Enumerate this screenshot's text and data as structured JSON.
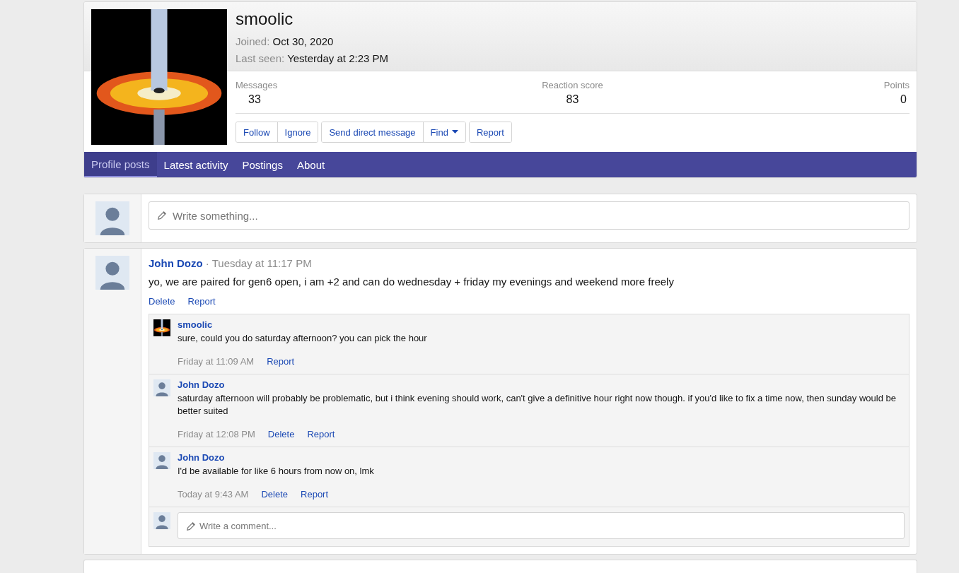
{
  "profile": {
    "name": "smoolic",
    "facts": [
      {
        "label": "Joined:",
        "value": "Oct 30, 2020"
      },
      {
        "label": "Last seen:",
        "value": "Yesterday at 2:23 PM"
      }
    ],
    "stats": [
      {
        "label": "Messages",
        "value": "33"
      },
      {
        "label": "Reaction score",
        "value": "83"
      },
      {
        "label": "Points",
        "value": "0"
      }
    ],
    "button_groups": [
      [
        {
          "label": "Follow",
          "has_menu": false
        },
        {
          "label": "Ignore",
          "has_menu": false
        }
      ],
      [
        {
          "label": "Send direct message",
          "has_menu": false
        },
        {
          "label": "Find",
          "has_menu": true
        }
      ],
      [
        {
          "label": "Report",
          "has_menu": false
        }
      ]
    ]
  },
  "tabs": [
    {
      "label": "Profile posts",
      "selected": true
    },
    {
      "label": "Latest activity",
      "selected": false
    },
    {
      "label": "Postings",
      "selected": false
    },
    {
      "label": "About",
      "selected": false
    }
  ],
  "composer": {
    "placeholder": "Write something..."
  },
  "posts": [
    {
      "author": "John Dozo",
      "separator": "·",
      "time": "Tuesday at 11:17 PM",
      "body": "yo, we are paired for gen6 open, i am +2 and can do wednesday + friday my evenings and weekend more freely",
      "actions": [
        "Delete",
        "Report"
      ],
      "comments": [
        {
          "kind": "owner",
          "author": "smoolic",
          "body": "sure, could you do saturday afternoon? you can pick the hour",
          "time": "Friday at 11:09 AM",
          "actions": [
            "Report"
          ]
        },
        {
          "kind": "visitor",
          "author": "John Dozo",
          "body": "saturday afternoon will probably be problematic, but i think evening should work, can't give a definitive hour right now though. if you'd like to fix a time now, then sunday would be better suited",
          "time": "Friday at 12:08 PM",
          "actions": [
            "Delete",
            "Report"
          ]
        },
        {
          "kind": "visitor",
          "author": "John Dozo",
          "body": "I'd be available for like 6 hours from now on, lmk",
          "time": "Today at 9:43 AM",
          "actions": [
            "Delete",
            "Report"
          ]
        }
      ],
      "comment_box": {
        "placeholder": "Write a comment..."
      }
    }
  ]
}
